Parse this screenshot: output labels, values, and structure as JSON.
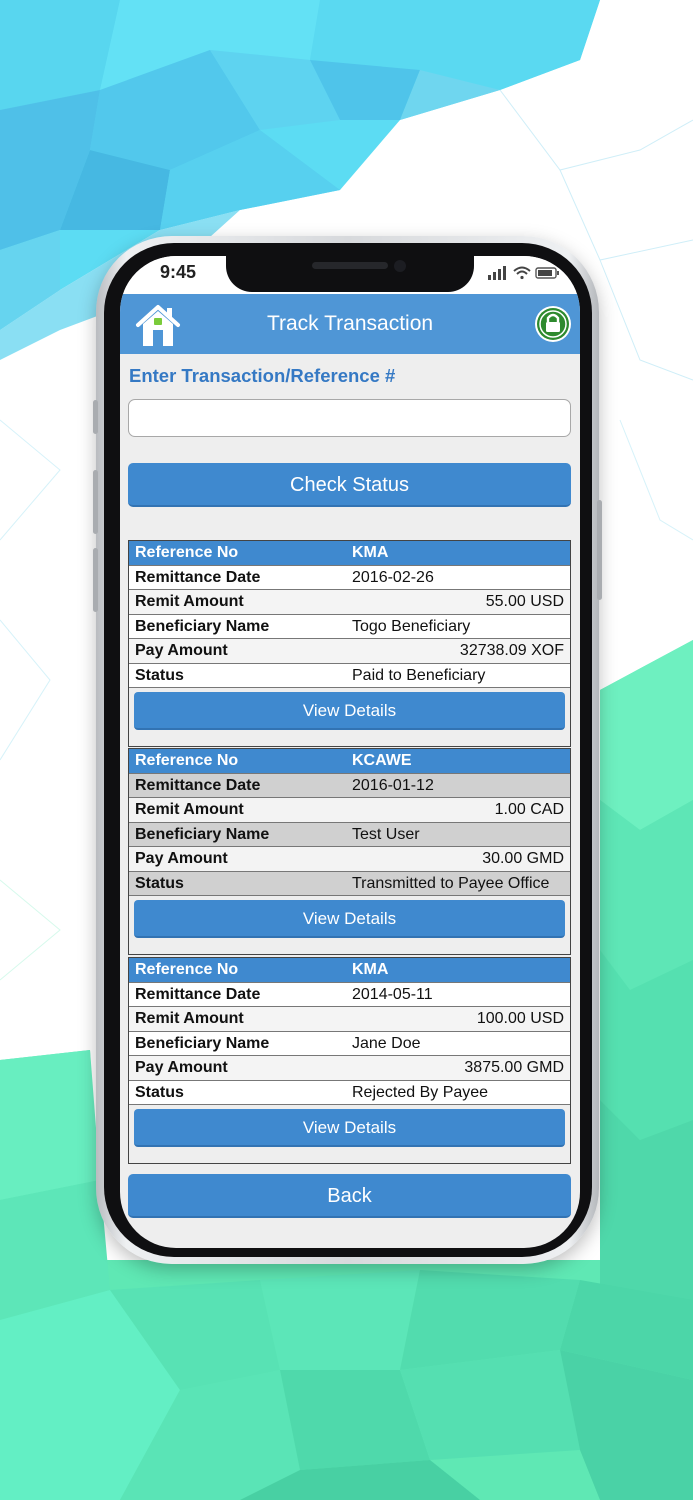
{
  "colors": {
    "header_blue": "#4f96d6",
    "button_blue": "#3f89cf",
    "label_blue": "#3579c4",
    "lock_green": "#2e8a2e"
  },
  "status_bar": {
    "time": "9:45",
    "icons": [
      "signal-icon",
      "wifi-icon",
      "battery-icon"
    ]
  },
  "header": {
    "title": "Track Transaction",
    "left_icon": "home-icon",
    "right_icon": "lock-icon"
  },
  "search": {
    "label": "Enter Transaction/Reference #",
    "value": "",
    "placeholder": "",
    "button_label": "Check Status"
  },
  "field_labels": {
    "reference": "Reference No",
    "date": "Remittance Date",
    "remit_amount": "Remit Amount",
    "beneficiary": "Beneficiary Name",
    "pay_amount": "Pay Amount",
    "status": "Status"
  },
  "transactions": [
    {
      "reference": "KMA",
      "date": "2016-02-26",
      "remit_amount": "55.00 USD",
      "beneficiary": "Togo Beneficiary",
      "pay_amount": "32738.09 XOF",
      "status": "Paid to Beneficiary",
      "button_label": "View Details"
    },
    {
      "reference": "KCAWE",
      "date": "2016-01-12",
      "remit_amount": "1.00 CAD",
      "beneficiary": "Test User",
      "pay_amount": "30.00 GMD",
      "status": "Transmitted to Payee Office",
      "button_label": "View Details"
    },
    {
      "reference": "KMA",
      "date": "2014-05-11",
      "remit_amount": "100.00 USD",
      "beneficiary": "Jane Doe",
      "pay_amount": "3875.00 GMD",
      "status": "Rejected By Payee",
      "button_label": "View Details"
    }
  ],
  "footer": {
    "back_label": "Back"
  }
}
